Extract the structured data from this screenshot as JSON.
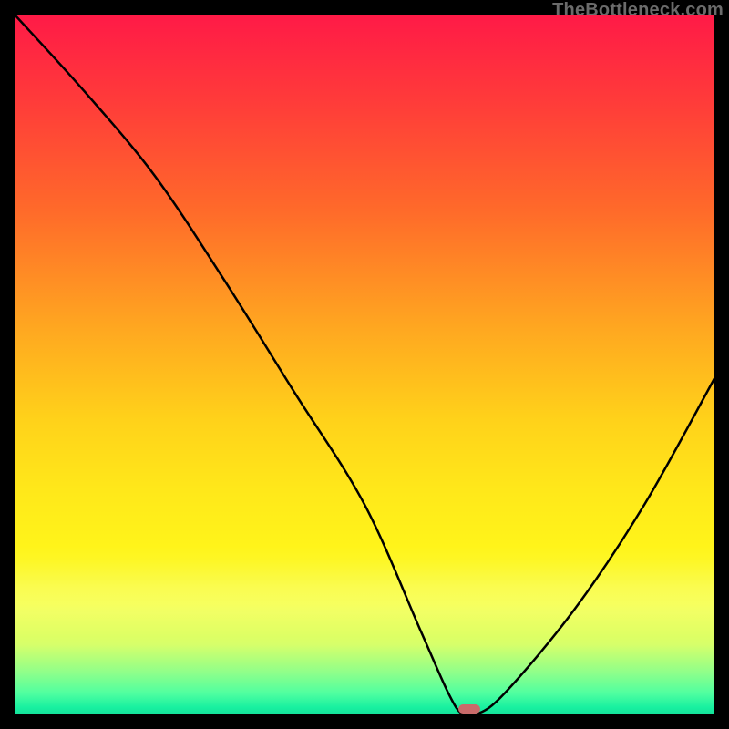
{
  "attribution": "TheBottleneck.com",
  "chart_data": {
    "type": "line",
    "title": "",
    "xlabel": "",
    "ylabel": "",
    "xlim": [
      0,
      100
    ],
    "ylim": [
      0,
      100
    ],
    "grid": false,
    "legend": false,
    "x": [
      0,
      10,
      20,
      30,
      40,
      50,
      58,
      62,
      64,
      66,
      70,
      80,
      90,
      100
    ],
    "values": [
      100,
      89,
      77,
      62,
      46,
      30,
      12,
      3,
      0,
      0,
      3,
      15,
      30,
      48
    ],
    "optimum_x": 65,
    "gradient_stops": [
      {
        "pos": 0.0,
        "color": "#ff1a47"
      },
      {
        "pos": 0.3,
        "color": "#ff6a2a"
      },
      {
        "pos": 0.55,
        "color": "#ffd21a"
      },
      {
        "pos": 0.75,
        "color": "#fff41a"
      },
      {
        "pos": 0.9,
        "color": "#d7ff6a"
      },
      {
        "pos": 1.0,
        "color": "#14e09a"
      }
    ],
    "marker": {
      "color": "#c96a6a",
      "shape": "pill"
    }
  }
}
